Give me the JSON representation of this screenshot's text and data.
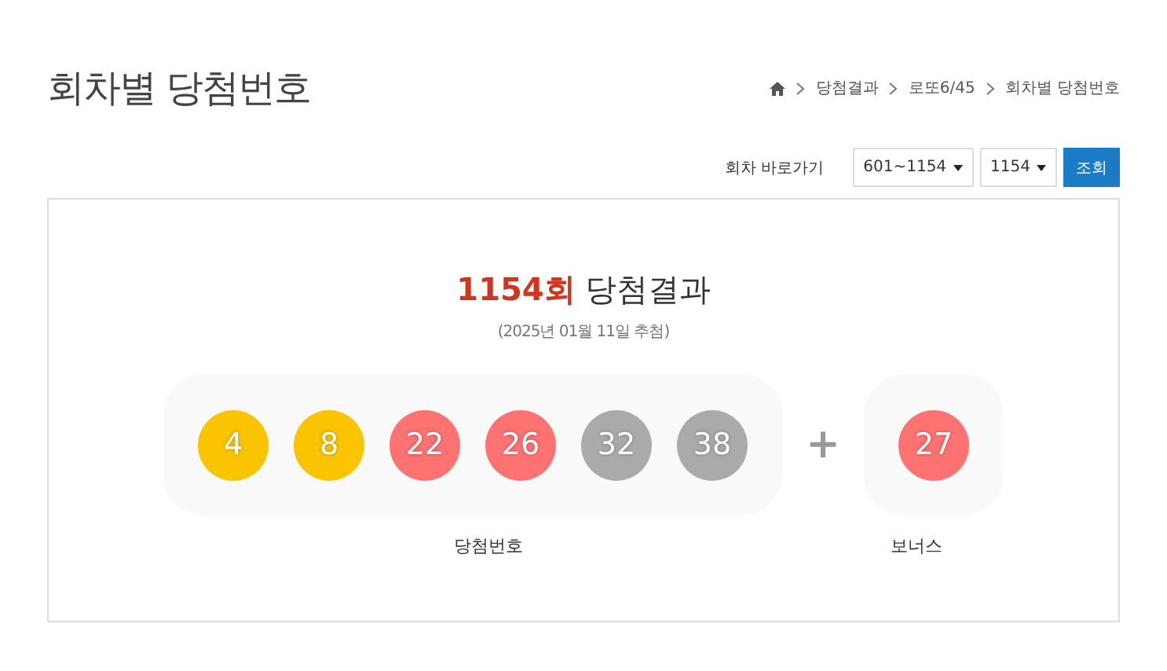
{
  "page_title": "회차별 당첨번호",
  "breadcrumb": [
    "당첨결과",
    "로또6/45",
    "회차별 당첨번호"
  ],
  "round_nav": {
    "label": "회차 바로가기",
    "range_select": "601~1154",
    "round_select": "1154",
    "submit": "조회"
  },
  "result": {
    "round": "1154회",
    "title": "당첨결과",
    "date": "(2025년 01월 11일 추첨)",
    "numbers": [
      {
        "value": "4",
        "color": "#fbc400"
      },
      {
        "value": "8",
        "color": "#fbc400"
      },
      {
        "value": "22",
        "color": "#ff7272"
      },
      {
        "value": "26",
        "color": "#ff7272"
      },
      {
        "value": "32",
        "color": "#aaaaaa"
      },
      {
        "value": "38",
        "color": "#aaaaaa"
      }
    ],
    "plus": "+",
    "bonus": {
      "value": "27",
      "color": "#ff7272"
    },
    "numbers_label": "당첨번호",
    "bonus_label": "보너스"
  }
}
